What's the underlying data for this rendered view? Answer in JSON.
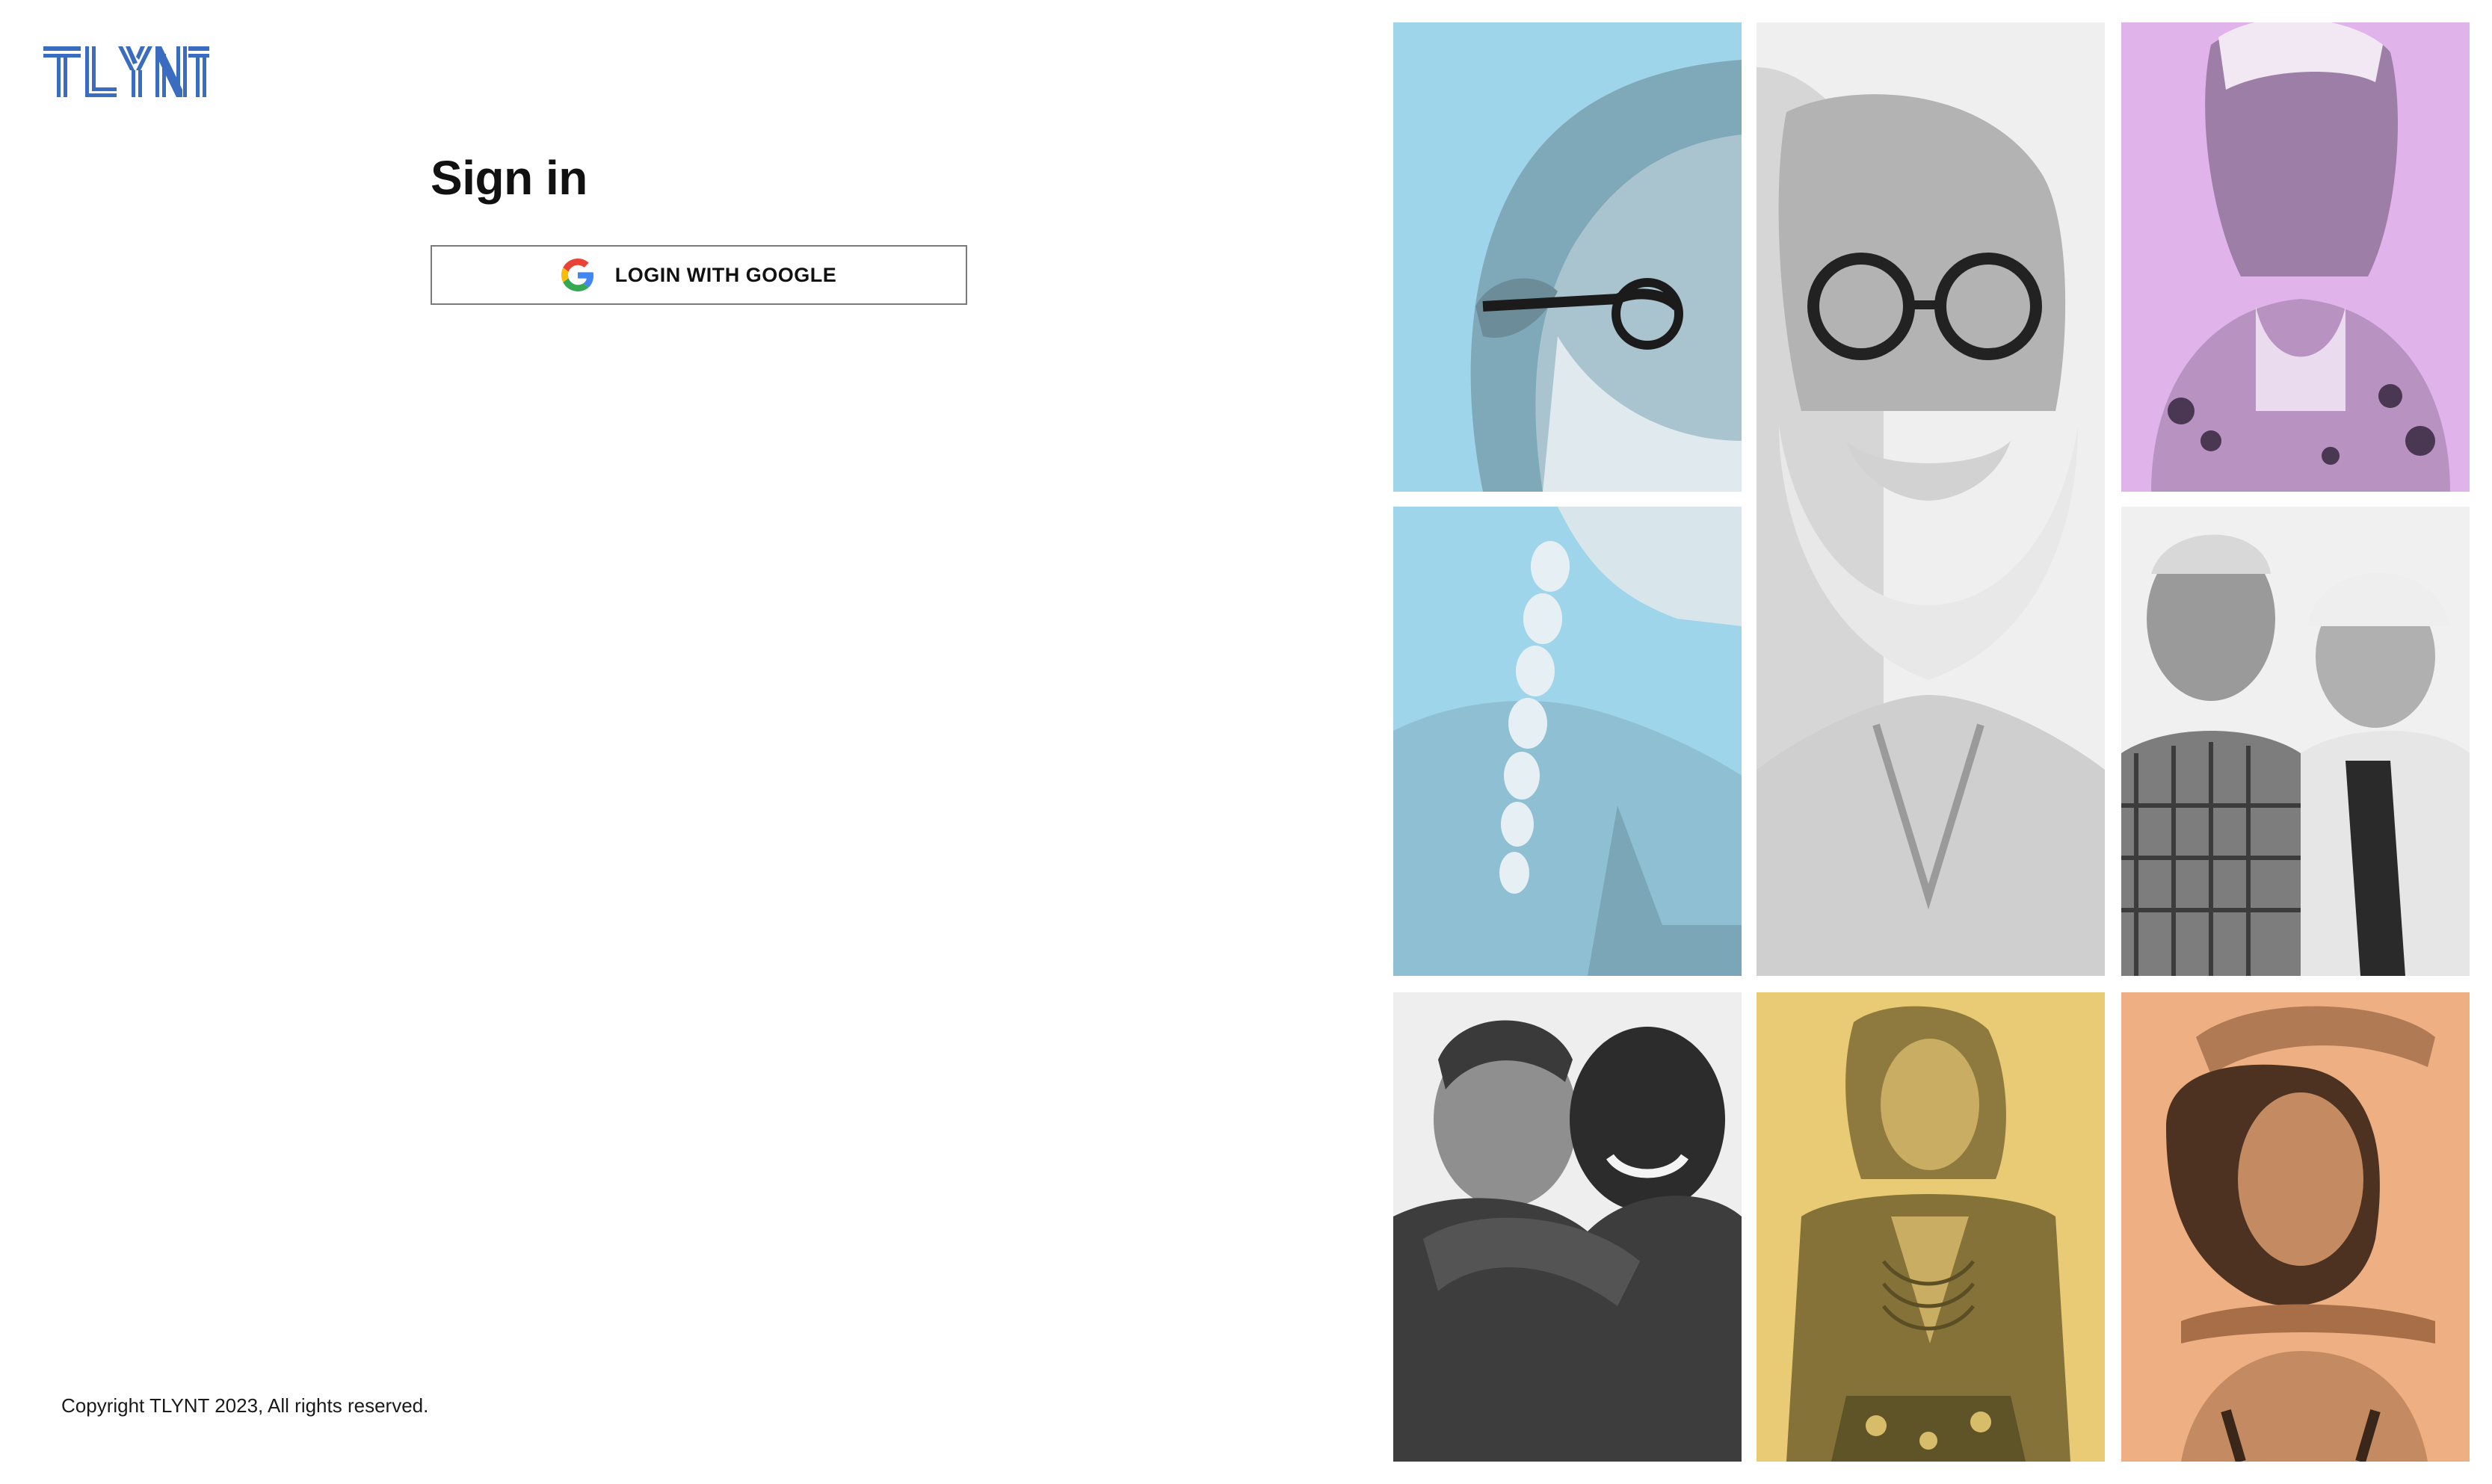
{
  "brand": {
    "name": "TLYNT",
    "color": "#3a6cc0"
  },
  "signin": {
    "title": "Sign in",
    "google_button_label": "LOGIN WITH GOOGLE",
    "google_icon": "google-g-icon"
  },
  "footer": {
    "copyright": "Copyright TLYNT 2023, All rights reserved."
  },
  "photos": [
    {
      "subject": "man-with-glasses-and-white-beard",
      "tint": "#9fd5ea"
    },
    {
      "subject": "man-with-braided-white-hair",
      "tint": "#9fd5ea"
    },
    {
      "subject": "bearded-man-with-round-glasses",
      "tint": "#efefef"
    },
    {
      "subject": "tattooed-person",
      "tint": "#e0b4ea"
    },
    {
      "subject": "elderly-couple",
      "tint": "#f0f0f0"
    },
    {
      "subject": "two-men-hugging",
      "tint": "#eeeeee"
    },
    {
      "subject": "woman-in-cropped-jacket",
      "tint": "#e8cb74"
    },
    {
      "subject": "woman-with-curly-hair",
      "tint": "#eeaf82"
    }
  ]
}
